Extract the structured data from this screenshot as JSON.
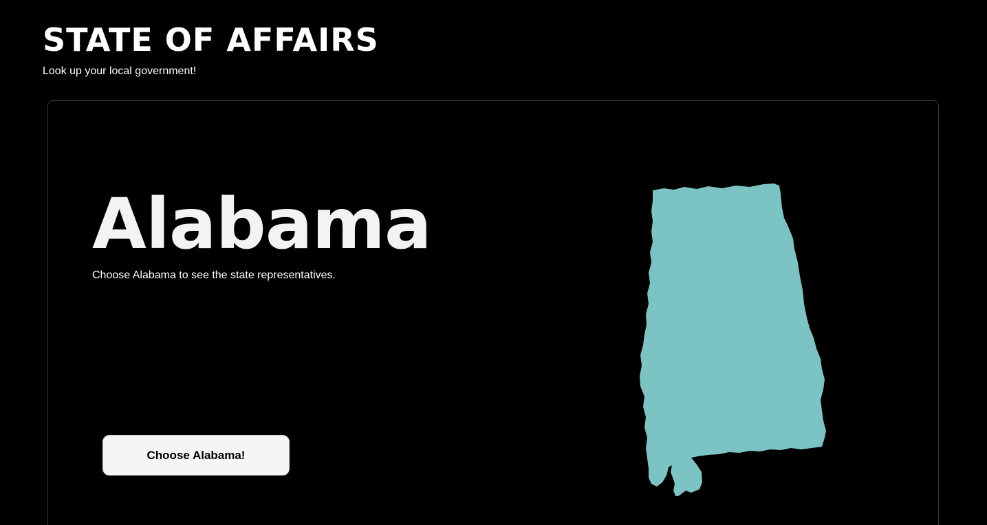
{
  "header": {
    "title": "STATE OF AFFAIRS",
    "subtitle": "Look up your local government!"
  },
  "state_card": {
    "state_name": "Alabama",
    "description": "Choose Alabama to see the state representatives.",
    "button_label": "Choose Alabama!",
    "map_icon": "alabama-state-map",
    "map_color": "#7cc4c4"
  }
}
